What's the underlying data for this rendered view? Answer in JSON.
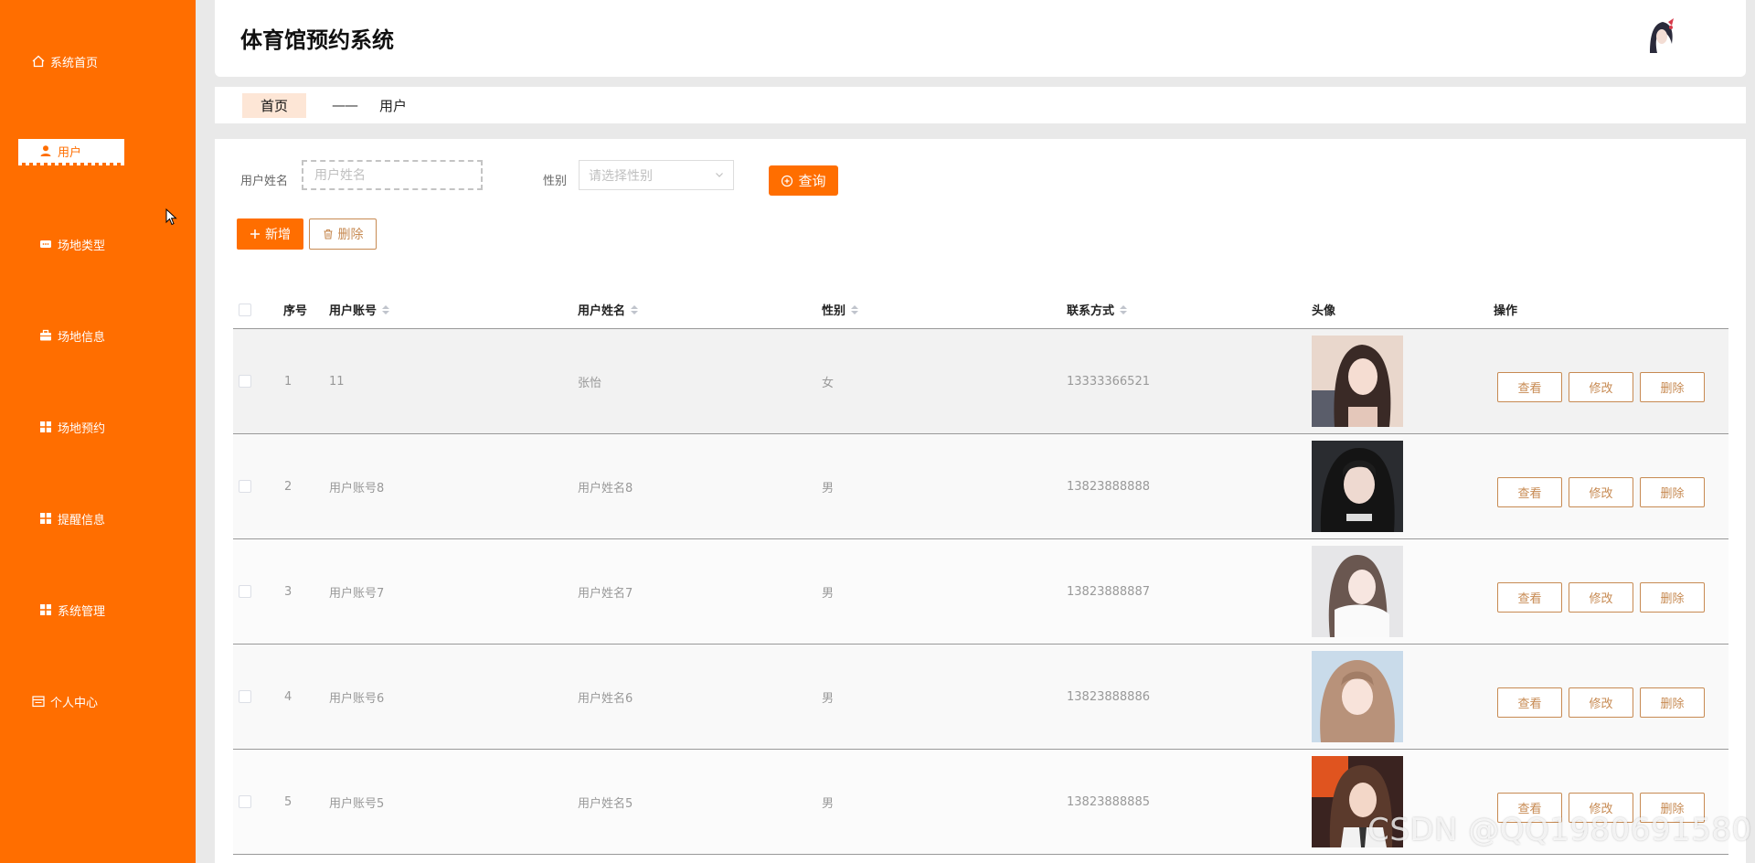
{
  "app": {
    "title": "体育馆预约系统"
  },
  "sidebar": {
    "items": [
      {
        "label": "系统首页",
        "icon": "home-icon",
        "active": false
      },
      {
        "label": "用户",
        "icon": "user-icon",
        "active": true
      },
      {
        "label": "场地类型",
        "icon": "chat-icon",
        "active": false
      },
      {
        "label": "场地信息",
        "icon": "briefcase-icon",
        "active": false
      },
      {
        "label": "场地预约",
        "icon": "grid-icon",
        "active": false
      },
      {
        "label": "提醒信息",
        "icon": "grid-icon",
        "active": false
      },
      {
        "label": "系统管理",
        "icon": "grid-icon",
        "active": false
      },
      {
        "label": "个人中心",
        "icon": "calendar-icon",
        "active": false
      }
    ]
  },
  "breadcrumb": {
    "home": "首页",
    "separator": "——",
    "current": "用户"
  },
  "search": {
    "name_label": "用户姓名",
    "name_placeholder": "用户姓名",
    "gender_label": "性别",
    "gender_placeholder": "请选择性别",
    "query_label": "查询"
  },
  "toolbar": {
    "add_label": "新增",
    "delete_label": "删除"
  },
  "table": {
    "headers": {
      "index": "序号",
      "account": "用户账号",
      "name": "用户姓名",
      "gender": "性别",
      "phone": "联系方式",
      "avatar": "头像",
      "actions": "操作"
    },
    "rows": [
      {
        "index": "1",
        "account": "11",
        "name": "张怡",
        "gender": "女",
        "phone": "13333366521"
      },
      {
        "index": "2",
        "account": "用户账号8",
        "name": "用户姓名8",
        "gender": "男",
        "phone": "13823888888"
      },
      {
        "index": "3",
        "account": "用户账号7",
        "name": "用户姓名7",
        "gender": "男",
        "phone": "13823888887"
      },
      {
        "index": "4",
        "account": "用户账号6",
        "name": "用户姓名6",
        "gender": "男",
        "phone": "13823888886"
      },
      {
        "index": "5",
        "account": "用户账号5",
        "name": "用户姓名5",
        "gender": "男",
        "phone": "13823888885"
      }
    ],
    "row_actions": {
      "view": "查看",
      "edit": "修改",
      "delete": "删除"
    }
  },
  "watermark": "CSDN @QQ1980691580",
  "colors": {
    "accent": "#ff6e00",
    "outline": "#c78a52"
  }
}
